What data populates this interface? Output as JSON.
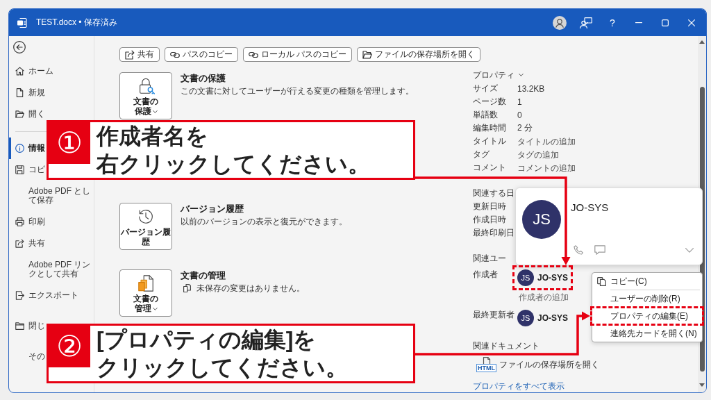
{
  "window": {
    "title": "TEST.docx • 保存済み",
    "help_label": "?"
  },
  "sidebar": {
    "groups": [
      {
        "items": [
          {
            "label": "ホーム",
            "selected": false
          },
          {
            "label": "新規",
            "selected": false
          },
          {
            "label": "開く",
            "selected": false
          }
        ]
      },
      {
        "divider": true,
        "items": [
          {
            "label": "情報",
            "selected": true
          },
          {
            "label": "コピ",
            "selected": false
          },
          {
            "label": "Adobe PDF として保存",
            "selected": false
          },
          {
            "label": "印刷",
            "selected": false
          },
          {
            "label": "共有",
            "selected": false
          },
          {
            "label": "Adobe PDF リンクとして共有",
            "selected": false
          },
          {
            "label": "エクスポート",
            "selected": false
          }
        ]
      },
      {
        "items": [
          {
            "label": "閉じ",
            "selected": false
          },
          {
            "label": "その",
            "selected": false
          }
        ]
      }
    ]
  },
  "actions": [
    {
      "label": "共有"
    },
    {
      "label": "パスのコピー"
    },
    {
      "label": "ローカル パスのコピー"
    },
    {
      "label": "ファイルの保存場所を開く"
    }
  ],
  "sections": [
    {
      "button_label": "文書の保護",
      "dropdown": true,
      "title": "文書の保護",
      "description": "この文書に対してユーザーが行える変更の種類を管理します。"
    },
    {
      "button_label": "バージョン履歴",
      "dropdown": false,
      "title": "バージョン履歴",
      "description": "以前のバージョンの表示と復元ができます。"
    },
    {
      "button_label": "文書の管理",
      "dropdown": true,
      "title": "文書の管理",
      "description": "未保存の変更はありません。"
    }
  ],
  "properties": {
    "heading": "プロパティ",
    "rows": [
      {
        "label": "サイズ",
        "value": "13.2KB"
      },
      {
        "label": "ページ数",
        "value": "1"
      },
      {
        "label": "単語数",
        "value": "0"
      },
      {
        "label": "編集時間",
        "value": "2 分"
      },
      {
        "label": "タイトル",
        "placeholder": "タイトルの追加"
      },
      {
        "label": "タグ",
        "placeholder": "タグの追加"
      },
      {
        "label": "コメント",
        "placeholder": "コメントの追加"
      }
    ]
  },
  "related_dates": {
    "heading": "関連する日",
    "rows": [
      {
        "label": "更新日時"
      },
      {
        "label": "作成日時"
      },
      {
        "label": "最終印刷日"
      }
    ]
  },
  "related_people": {
    "heading": "関連ユー",
    "rows": [
      {
        "label": "作成者",
        "initials": "JS",
        "name": "JO-SYS",
        "highlighted": true,
        "placeholder": "作成者の追加"
      },
      {
        "label": "最終更新者",
        "initials": "JS",
        "name": "JO-SYS",
        "highlighted": false
      }
    ]
  },
  "related_documents": {
    "heading": "関連ドキュメント",
    "items": [
      {
        "type_label": "HTML",
        "label": "ファイルの保存場所を開く"
      }
    ]
  },
  "show_all_link": "プロパティをすべて表示",
  "contact_card": {
    "initials": "JS",
    "name": "JO-SYS"
  },
  "context_menu": {
    "groups": [
      {
        "items": [
          {
            "label": "コピー(C)",
            "highlighted": false
          }
        ]
      },
      {
        "items": [
          {
            "label": "ユーザーの削除(R)",
            "highlighted": false
          },
          {
            "label": "プロパティの編集(E)",
            "highlighted": true
          },
          {
            "label": "連絡先カードを開く(N)",
            "highlighted": false
          }
        ]
      }
    ]
  },
  "callouts": [
    {
      "number": "①",
      "text": "作成者名を右クリックしてください。"
    },
    {
      "number": "②",
      "text": "[プロパティの編集]をクリックしてください。"
    }
  ]
}
